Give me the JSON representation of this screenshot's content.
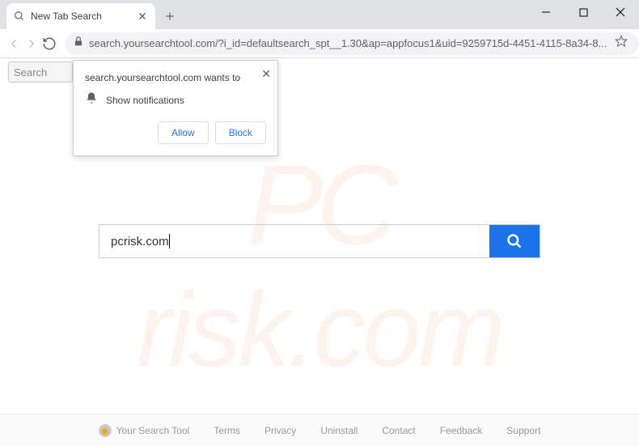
{
  "tab": {
    "title": "New Tab Search"
  },
  "url": "search.yoursearchtool.com/?i_id=defaultsearch_spt__1.30&ap=appfocus1&uid=9259715d-4451-4115-8a34-8...",
  "top_search_placeholder": "Search",
  "notification": {
    "title": "search.yoursearchtool.com wants to",
    "body": "Show notifications",
    "allow": "Allow",
    "block": "Block"
  },
  "main_search": {
    "value": "pcrisk.com"
  },
  "footer": {
    "brand": "Your Search Tool",
    "links": [
      "Terms",
      "Privacy",
      "Uninstall",
      "Contact",
      "Feedback",
      "Support"
    ]
  },
  "watermark": {
    "line1": "PC",
    "line2": "risk.com"
  }
}
